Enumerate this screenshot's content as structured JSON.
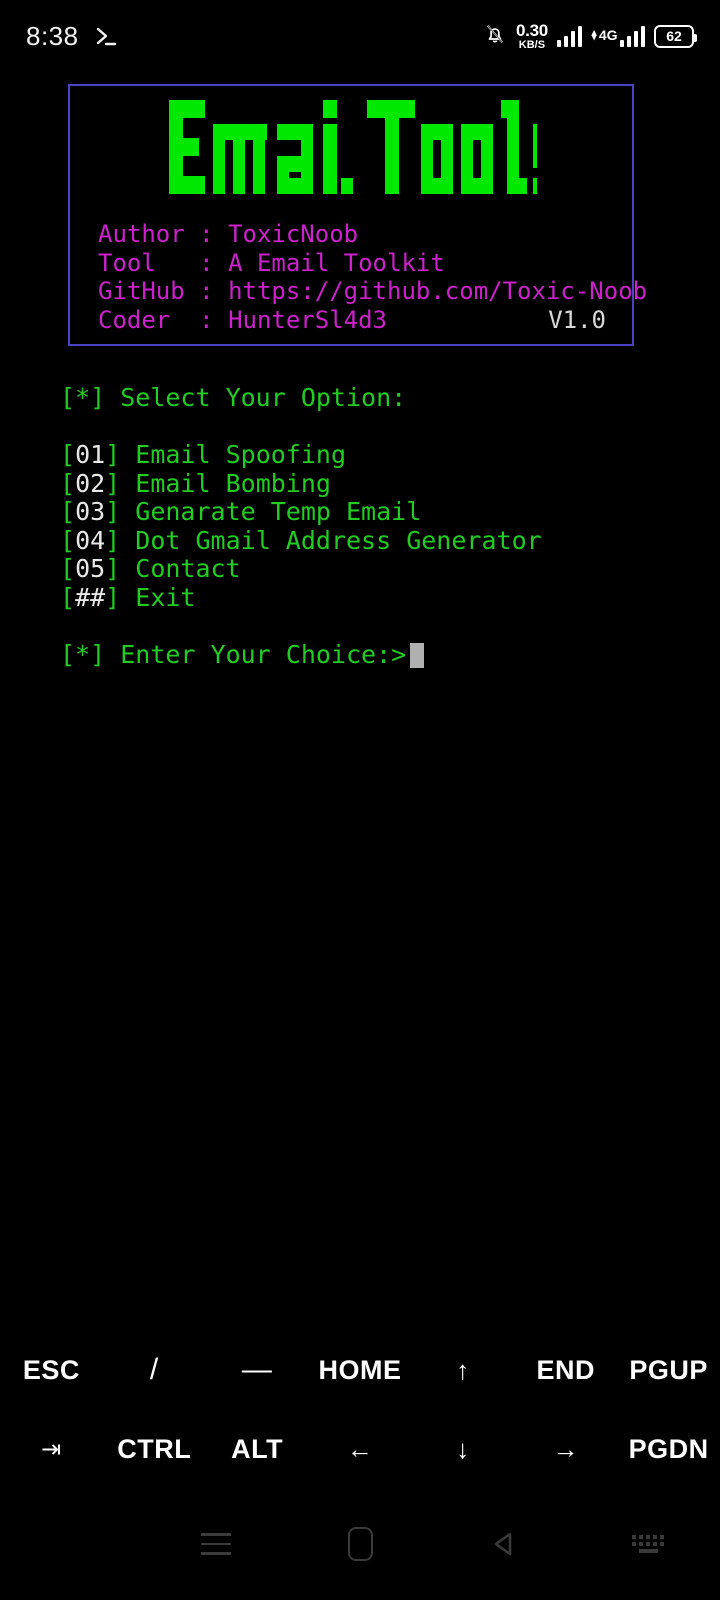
{
  "statusbar": {
    "time": "8:38",
    "prompt_icon": "terminal-prompt-icon",
    "notification_icon": "bell-muted-icon",
    "net_speed_value": "0.30",
    "net_speed_unit": "KB/S",
    "network_type": "4G",
    "battery_level": "62",
    "signal_icon": "signal-bars-icon"
  },
  "banner": {
    "border_color": "#4a44c4",
    "ascii_title": "Email Tools",
    "ascii_color": "#00e800",
    "info_color": "#cc22cc",
    "version": "V1.0",
    "lines": [
      {
        "key": "Author ",
        "sep": ": ",
        "value": "ToxicNoob"
      },
      {
        "key": "Tool   ",
        "sep": ": ",
        "value": "A Email Toolkit"
      },
      {
        "key": "GitHub ",
        "sep": ": ",
        "value": "https://github.com/Toxic-Noob"
      },
      {
        "key": "Coder  ",
        "sep": ": ",
        "value": "HunterSl4d3"
      }
    ]
  },
  "menu": {
    "prompt_label": "[*] Select Your Option:",
    "text_color": "#22cc22",
    "number_color": "#e8e8e8",
    "options": [
      {
        "bracket_open": "[",
        "num": "01",
        "bracket_close": "] ",
        "label": "Email Spoofing"
      },
      {
        "bracket_open": "[",
        "num": "02",
        "bracket_close": "] ",
        "label": "Email Bombing"
      },
      {
        "bracket_open": "[",
        "num": "03",
        "bracket_close": "] ",
        "label": "Genarate Temp Email"
      },
      {
        "bracket_open": "[",
        "num": "04",
        "bracket_close": "] ",
        "label": "Dot Gmail Address Generator"
      },
      {
        "bracket_open": "[",
        "num": "05",
        "bracket_close": "] ",
        "label": "Contact"
      },
      {
        "bracket_open": "[",
        "num": "##",
        "bracket_close": "] ",
        "label": "Exit"
      }
    ],
    "input_prompt": "[*] Enter Your Choice:>",
    "input_value": ""
  },
  "extra_keys": {
    "row1": [
      {
        "label": "ESC",
        "name": "key-esc",
        "style": ""
      },
      {
        "label": "/",
        "name": "key-slash",
        "style": "sym"
      },
      {
        "label": "—",
        "name": "key-dash",
        "style": "sym"
      },
      {
        "label": "HOME",
        "name": "key-home",
        "style": ""
      },
      {
        "label": "↑",
        "name": "key-arrow-up",
        "style": "arrow"
      },
      {
        "label": "END",
        "name": "key-end",
        "style": ""
      },
      {
        "label": "PGUP",
        "name": "key-pgup",
        "style": ""
      }
    ],
    "row2": [
      {
        "label": "⇥",
        "name": "key-tab",
        "style": "tabicon"
      },
      {
        "label": "CTRL",
        "name": "key-ctrl",
        "style": ""
      },
      {
        "label": "ALT",
        "name": "key-alt",
        "style": ""
      },
      {
        "label": "←",
        "name": "key-arrow-left",
        "style": "arrow"
      },
      {
        "label": "↓",
        "name": "key-arrow-down",
        "style": "arrow"
      },
      {
        "label": "→",
        "name": "key-arrow-right",
        "style": "arrow"
      },
      {
        "label": "PGDN",
        "name": "key-pgdn",
        "style": ""
      }
    ]
  },
  "navbar": {
    "recents_icon": "recents-menu-icon",
    "home_icon": "home-icon",
    "back_icon": "back-triangle-icon",
    "keyboard_icon": "keyboard-icon"
  }
}
